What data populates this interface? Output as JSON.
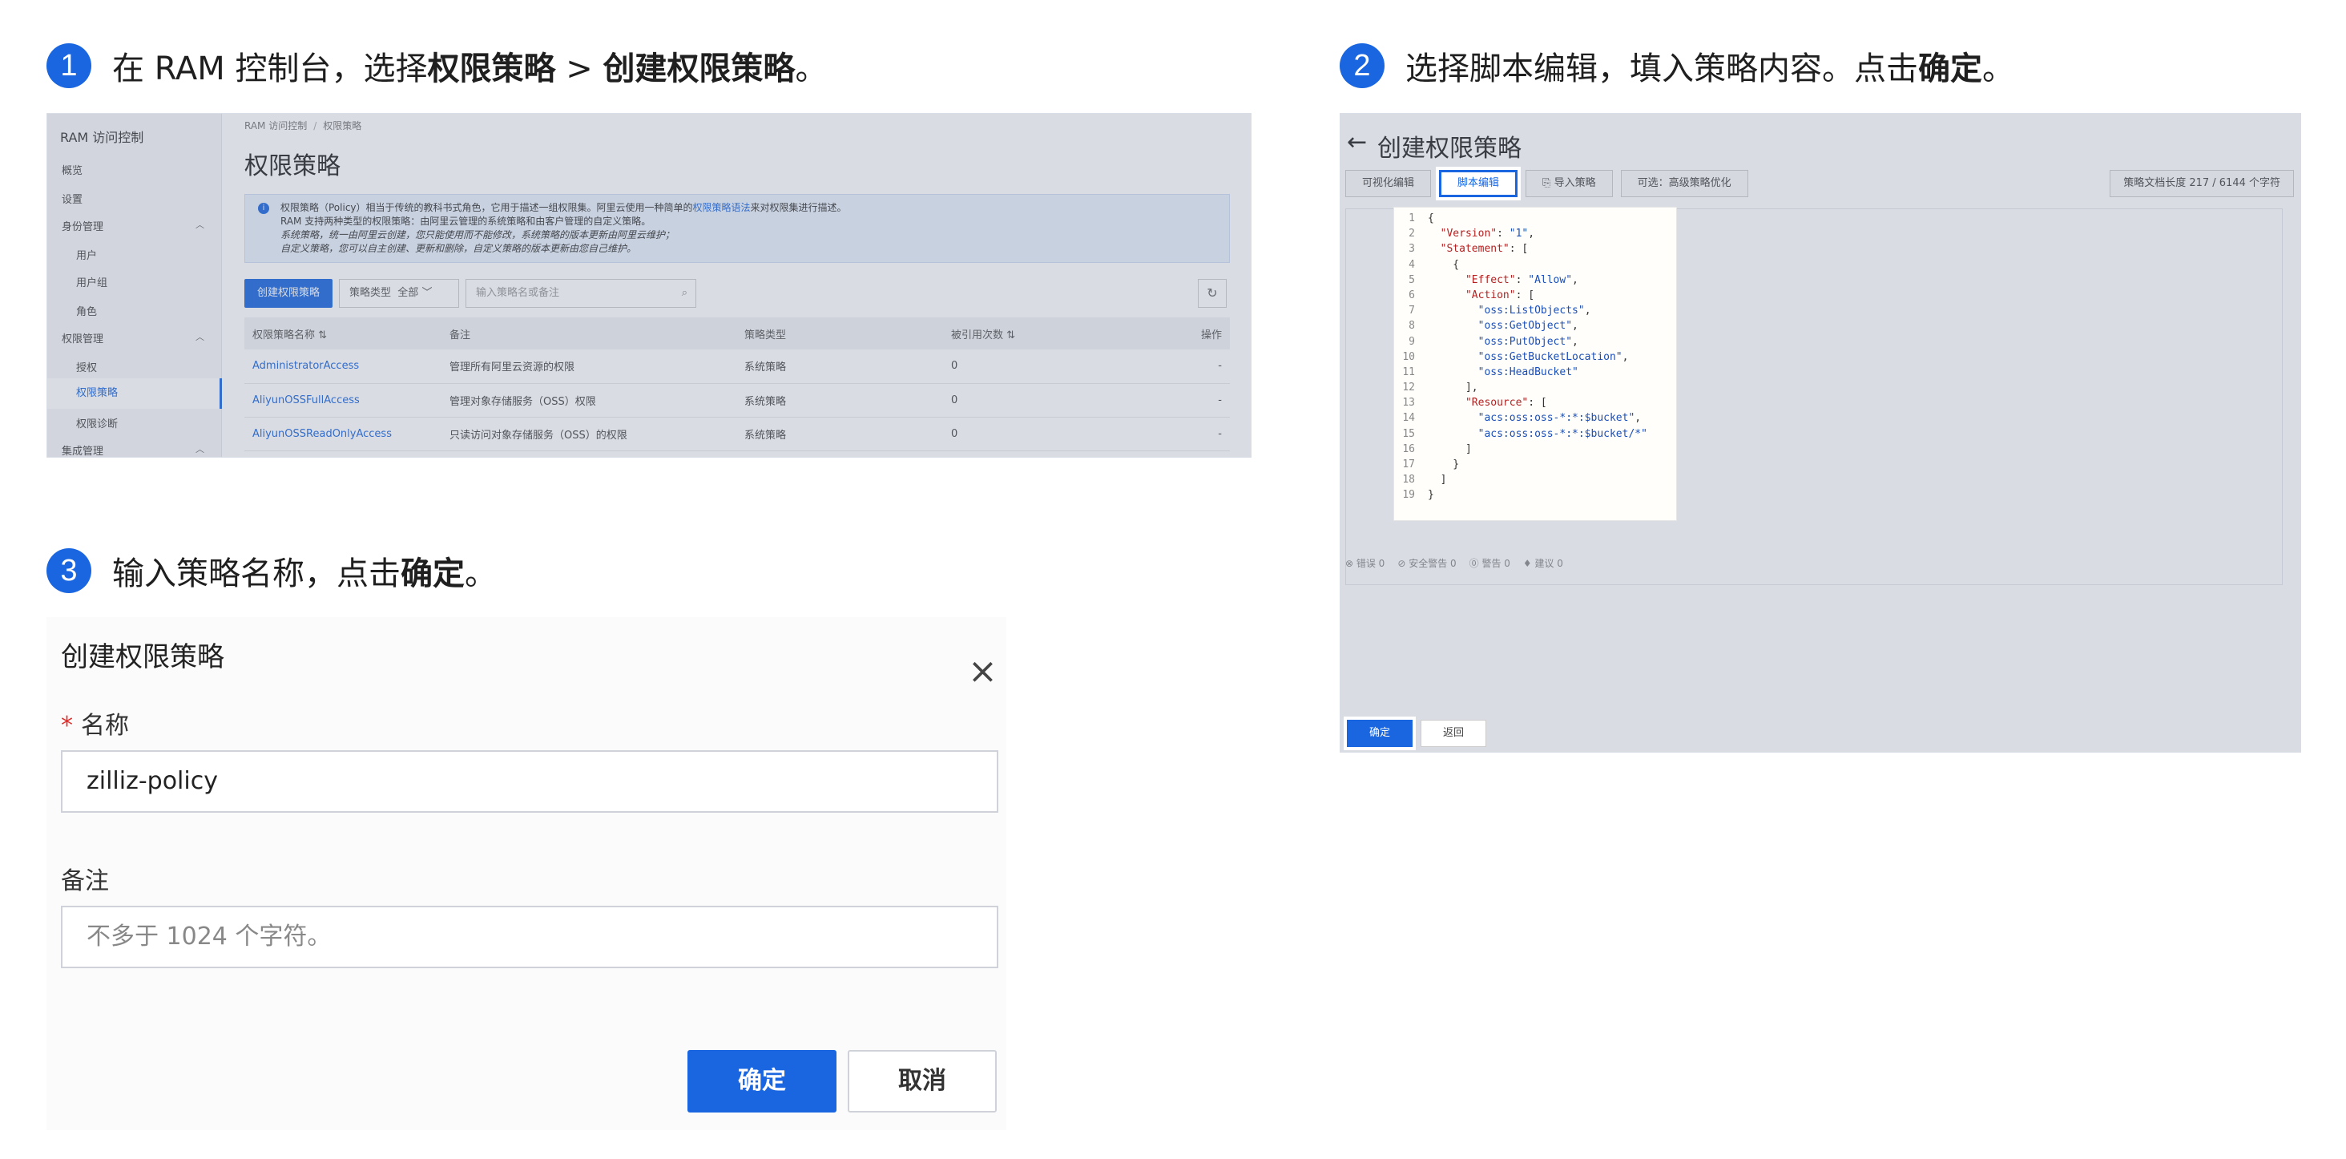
{
  "steps": [
    {
      "num": "1",
      "text_a": "在 RAM 控制台，选择",
      "bold_a": "权限策略",
      "text_b": " > ",
      "bold_b": "创建权限策略",
      "text_c": "。"
    },
    {
      "num": "2",
      "text_a": "选择脚本编辑，填入策略内容。点击",
      "bold_a": "确定",
      "text_b": "。"
    },
    {
      "num": "3",
      "text_a": "输入策略名称，点击",
      "bold_a": "确定",
      "text_b": "。"
    }
  ],
  "shot1": {
    "sidebar_title": "RAM 访问控制",
    "sidebar_items": [
      "概览",
      "设置",
      "身份管理",
      "用户",
      "用户组",
      "角色",
      "权限管理",
      "授权",
      "权限策略",
      "权限诊断",
      "集成管理"
    ],
    "breadcrumb": [
      "RAM 访问控制",
      "权限策略"
    ],
    "page_title": "权限策略",
    "notice": {
      "line1_a": "权限策略（Policy）相当于传统的教科书式角色，它用于描述一组权限集。阿里云使用一种简单的",
      "line1_link": "权限策略语法",
      "line1_b": "来对权限集进行描述。",
      "line2": "RAM 支持两种类型的权限策略：由阿里云管理的系统策略和由客户管理的自定义策略。",
      "line3_em": "系统策略",
      "line3": "，统一由阿里云创建，您只能使用而不能修改，系统策略的版本更新由阿里云维护；",
      "line4_em": "自定义策略",
      "line4": "，您可以自主创建、更新和删除，自定义策略的版本更新由您自己维护。"
    },
    "create_button": "创建权限策略",
    "filter_label": "策略类型",
    "filter_value": "全部",
    "search_placeholder": "输入策略名或备注",
    "columns": [
      "权限策略名称 ⇅",
      "备注",
      "策略类型",
      "被引用次数 ⇅",
      "操作"
    ],
    "rows": [
      [
        "AdministratorAccess",
        "管理所有阿里云资源的权限",
        "系统策略",
        "0",
        "-"
      ],
      [
        "AliyunOSSFullAccess",
        "管理对象存储服务（OSS）权限",
        "系统策略",
        "0",
        "-"
      ],
      [
        "AliyunOSSReadOnlyAccess",
        "只读访问对象存储服务（OSS）的权限",
        "系统策略",
        "0",
        "-"
      ]
    ]
  },
  "shot2": {
    "back_arrow": "←",
    "title": "创建权限策略",
    "tabs": [
      "可视化编辑",
      "脚本编辑",
      "导入策略",
      "可选：高级策略优化"
    ],
    "doc_length": "策略文档长度 217 / 6144 个字符",
    "code_lines": [
      [
        "1",
        "{"
      ],
      [
        "2",
        "  \"Version\": \"1\","
      ],
      [
        "3",
        "  \"Statement\": ["
      ],
      [
        "4",
        "    {"
      ],
      [
        "5",
        "      \"Effect\": \"Allow\","
      ],
      [
        "6",
        "      \"Action\": ["
      ],
      [
        "7",
        "        \"oss:ListObjects\","
      ],
      [
        "8",
        "        \"oss:GetObject\","
      ],
      [
        "9",
        "        \"oss:PutObject\","
      ],
      [
        "10",
        "        \"oss:GetBucketLocation\","
      ],
      [
        "11",
        "        \"oss:HeadBucket\""
      ],
      [
        "12",
        "      ],"
      ],
      [
        "13",
        "      \"Resource\": ["
      ],
      [
        "14",
        "        \"acs:oss:oss-*:*:$bucket\","
      ],
      [
        "15",
        "        \"acs:oss:oss-*:*:$bucket/*\""
      ],
      [
        "16",
        "      ]"
      ],
      [
        "17",
        "    }"
      ],
      [
        "18",
        "  ]"
      ],
      [
        "19",
        "}"
      ]
    ],
    "status_items": [
      "⊗ 错误 0",
      "⊘ 安全警告 0",
      "⓪ 警告 0",
      "♦ 建议 0"
    ],
    "ok_button": "确定",
    "back_button": "返回"
  },
  "shot3": {
    "dialog_title": "创建权限策略",
    "close_icon": "×",
    "name_required_mark": "*",
    "name_label": "名称",
    "name_value": "zilliz-policy",
    "note_label": "备注",
    "note_placeholder": "不多于 1024 个字符。",
    "ok_button": "确定",
    "cancel_button": "取消"
  },
  "colors": {
    "accent": "#1a66e0",
    "required": "#e0302d"
  }
}
